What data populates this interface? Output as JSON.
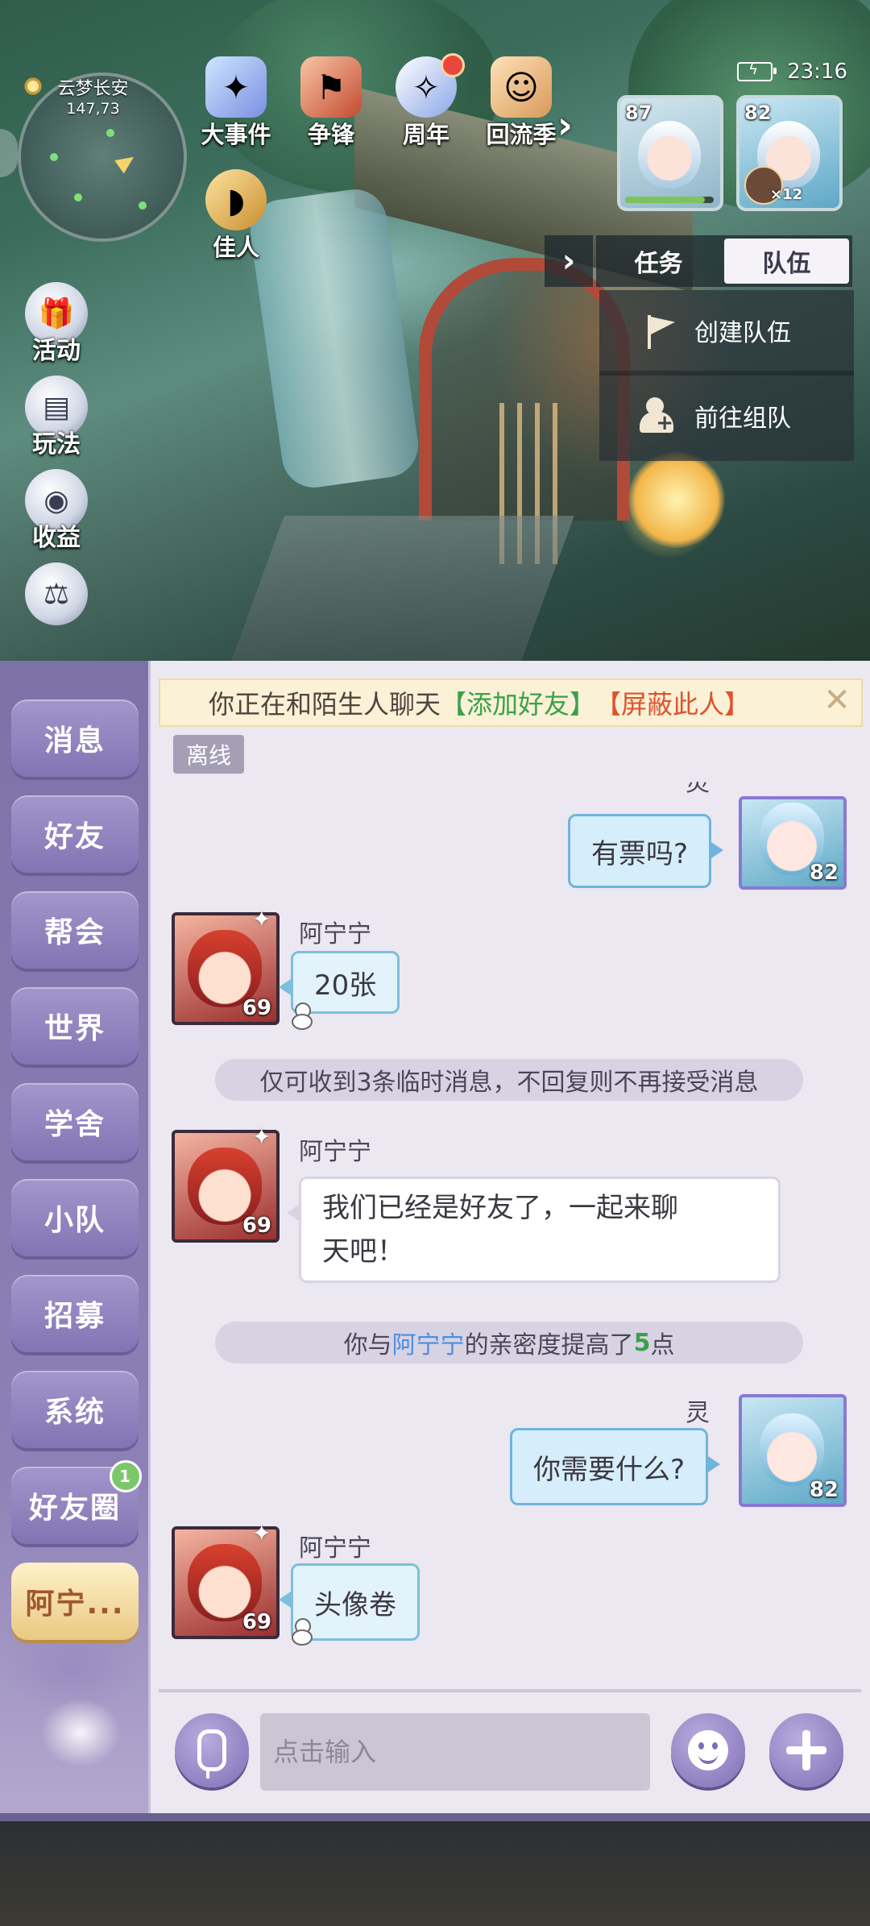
{
  "hud": {
    "map_name": "云梦长安",
    "map_coord": "147,73",
    "clock": "23:16",
    "menu": [
      {
        "label": "大事件",
        "icon": "event-icon"
      },
      {
        "label": "争锋",
        "icon": "battle-flag-icon"
      },
      {
        "label": "周年",
        "icon": "anniversary-icon"
      },
      {
        "label": "回流季",
        "icon": "return-season-icon"
      }
    ],
    "menu_row2": {
      "label": "佳人",
      "icon": "fan-icon"
    },
    "more_arrow": "›",
    "team": [
      {
        "level": "87"
      },
      {
        "level": "82",
        "pet_count": "×12"
      }
    ],
    "panel_toggle": "›",
    "panel_tabs": [
      "任务",
      "队伍"
    ],
    "panel_active_tab": "队伍",
    "panel_actions": [
      {
        "label": "创建队伍",
        "icon": "flag-icon"
      },
      {
        "label": "前往组队",
        "icon": "person-add-icon"
      }
    ],
    "side_icons": [
      {
        "label": "活动",
        "icon": "gift-box-icon"
      },
      {
        "label": "玩法",
        "icon": "book-icon"
      },
      {
        "label": "收益",
        "icon": "money-bag-icon"
      }
    ]
  },
  "chat": {
    "categories": [
      "消息",
      "好友",
      "帮会",
      "世界",
      "学舍",
      "小队",
      "招募",
      "系统",
      "好友圈",
      "阿宁..."
    ],
    "active_category": "阿宁...",
    "moments_badge": "1",
    "notice": {
      "text": "你正在和陌生人聊天",
      "add_friend": "【添加好友】",
      "block": "【屏蔽此人】",
      "close": "✕"
    },
    "status": "离线",
    "messages": [
      {
        "from": "self",
        "name": "灵",
        "level": "82",
        "text": "有票吗?"
      },
      {
        "from": "other",
        "name": "阿宁宁",
        "level": "69",
        "text": "20张"
      },
      {
        "system": "仅可收到3条临时消息，不回复则不再接受消息"
      },
      {
        "from": "other",
        "name": "阿宁宁",
        "level": "69",
        "text_line1": "我们已经是好友了，一起来聊",
        "text_line2": "天吧！"
      },
      {
        "system_intimacy": {
          "prefix": "你与",
          "name": "阿宁宁",
          "middle": "的亲密度提高了",
          "num": "5",
          "suffix": "点"
        }
      },
      {
        "from": "self",
        "name": "灵",
        "level": "82",
        "text": "你需要什么?"
      },
      {
        "from": "other",
        "name": "阿宁宁",
        "level": "69",
        "text": "头像卷"
      }
    ],
    "input_placeholder": "点击输入"
  }
}
